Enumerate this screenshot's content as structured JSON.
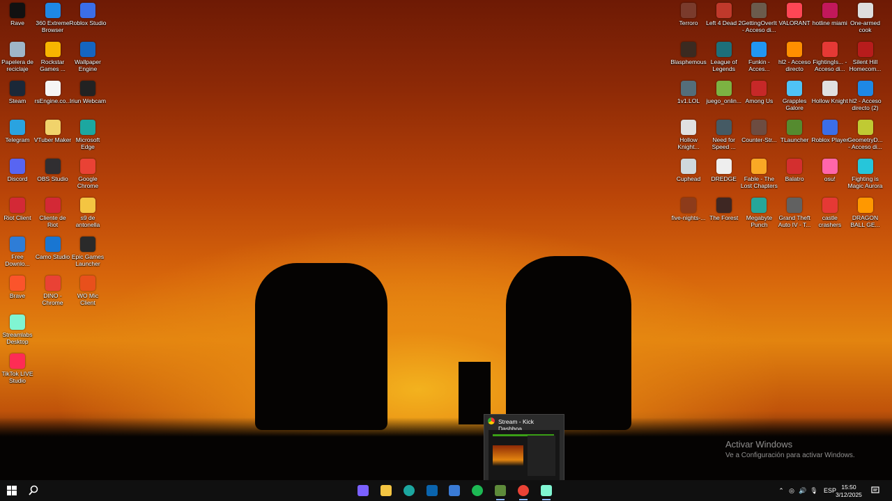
{
  "desktop_icons_left": [
    {
      "label": "Rave",
      "icon": "rave-icon",
      "color": "#111111"
    },
    {
      "label": "360 Extreme Browser",
      "icon": "360-browser-icon",
      "color": "#1e88e5"
    },
    {
      "label": "Roblox Studio",
      "icon": "roblox-studio-icon",
      "color": "#3b6ee8"
    },
    {
      "label": "Papelera de reciclaje",
      "icon": "recycle-bin-icon",
      "color": "#9fb6c8"
    },
    {
      "label": "Rockstar Games ...",
      "icon": "rockstar-icon",
      "color": "#f7b500"
    },
    {
      "label": "Wallpaper Engine",
      "icon": "wallpaper-engine-icon",
      "color": "#1565c0"
    },
    {
      "label": "Steam",
      "icon": "steam-icon",
      "color": "#1b2838"
    },
    {
      "label": "rsEngine.co...",
      "icon": "file-icon",
      "color": "#f5f5f5"
    },
    {
      "label": "Iriun Webcam",
      "icon": "iriun-icon",
      "color": "#222222"
    },
    {
      "label": "Telegram",
      "icon": "telegram-icon",
      "color": "#2aa3e0"
    },
    {
      "label": "VTuber Maker",
      "icon": "vtuber-maker-icon",
      "color": "#f1d36b"
    },
    {
      "label": "Microsoft Edge",
      "icon": "edge-icon",
      "color": "#1ca7a0"
    },
    {
      "label": "Discord",
      "icon": "discord-icon",
      "color": "#5865f2"
    },
    {
      "label": "OBS Studio",
      "icon": "obs-icon",
      "color": "#302e31"
    },
    {
      "label": "Google Chrome",
      "icon": "chrome-icon",
      "color": "#e94235"
    },
    {
      "label": "Riot Client",
      "icon": "riot-icon",
      "color": "#d32936"
    },
    {
      "label": "Cliente de Riot",
      "icon": "riot-icon",
      "color": "#d32936"
    },
    {
      "label": "s9 de antonella",
      "icon": "folder-icon",
      "color": "#f4c542"
    },
    {
      "label": "Free Downlo...",
      "icon": "free-download-icon",
      "color": "#2e7dd7"
    },
    {
      "label": "Camo Studio",
      "icon": "camo-icon",
      "color": "#1976d2"
    },
    {
      "label": "Epic Games Launcher",
      "icon": "epic-games-icon",
      "color": "#2a2a2a"
    },
    {
      "label": "Brave",
      "icon": "brave-icon",
      "color": "#fb542b"
    },
    {
      "label": "DINO - Chrome",
      "icon": "chrome-icon",
      "color": "#e94235"
    },
    {
      "label": "WO Mic Client",
      "icon": "mic-icon",
      "color": "#e8501c"
    },
    {
      "label": "Streamlabs Desktop",
      "icon": "streamlabs-icon",
      "color": "#80f5d2"
    },
    {
      "label": "TikTok LIVE Studio",
      "icon": "tiktok-icon",
      "color": "#fe2c55"
    }
  ],
  "desktop_icons_right": [
    {
      "label": "Terroro",
      "icon": "game-icon",
      "color": "#7a3b2c"
    },
    {
      "label": "Left 4 Dead 2",
      "icon": "game-icon",
      "color": "#c0392b"
    },
    {
      "label": "GettingOverIt - Acceso di...",
      "icon": "game-icon",
      "color": "#6b5b4c"
    },
    {
      "label": "VALORANT",
      "icon": "valorant-icon",
      "color": "#ff4655"
    },
    {
      "label": "hotline miami",
      "icon": "game-icon",
      "color": "#c2185b"
    },
    {
      "label": "One-armed cook",
      "icon": "game-icon",
      "color": "#dddddd"
    },
    {
      "label": "Blasphemous",
      "icon": "game-icon",
      "color": "#3b2a20"
    },
    {
      "label": "League of Legends",
      "icon": "lol-icon",
      "color": "#1d6f7a"
    },
    {
      "label": "Funkin - Acces...",
      "icon": "game-icon",
      "color": "#2196f3"
    },
    {
      "label": "hl2 - Acceso directo",
      "icon": "game-icon",
      "color": "#ff8f00"
    },
    {
      "label": "FightingIs... - Acceso di...",
      "icon": "game-icon",
      "color": "#e53935"
    },
    {
      "label": "Silent Hill Homecom...",
      "icon": "game-icon",
      "color": "#b71c1c"
    },
    {
      "label": "1v1.LOL",
      "icon": "game-icon",
      "color": "#546e7a"
    },
    {
      "label": "juego_onlin...",
      "icon": "game-icon",
      "color": "#7cb342"
    },
    {
      "label": "Among Us",
      "icon": "among-us-icon",
      "color": "#c62828"
    },
    {
      "label": "Grapples Galore",
      "icon": "game-icon",
      "color": "#4fc3f7"
    },
    {
      "label": "Hollow Knight",
      "icon": "game-icon",
      "color": "#e0e0e0"
    },
    {
      "label": "hl2 - Acceso directo (2)",
      "icon": "game-icon",
      "color": "#1e88e5"
    },
    {
      "label": "Hollow Knight...",
      "icon": "game-icon",
      "color": "#e0e0e0"
    },
    {
      "label": "Need for Speed ...",
      "icon": "game-icon",
      "color": "#455a64"
    },
    {
      "label": "Counter-Str...",
      "icon": "game-icon",
      "color": "#6d4c41"
    },
    {
      "label": "TLauncher",
      "icon": "game-icon",
      "color": "#558b2f"
    },
    {
      "label": "Roblox Player",
      "icon": "roblox-icon",
      "color": "#3b6ee8"
    },
    {
      "label": "GeometryD... - Acceso di...",
      "icon": "game-icon",
      "color": "#c0ca33"
    },
    {
      "label": "Cuphead",
      "icon": "game-icon",
      "color": "#cfd8dc"
    },
    {
      "label": "DREDGE",
      "icon": "game-icon",
      "color": "#eeeeee"
    },
    {
      "label": "Fable - The Lost Chapters",
      "icon": "game-icon",
      "color": "#f9a825"
    },
    {
      "label": "Balatro",
      "icon": "game-icon",
      "color": "#d32f2f"
    },
    {
      "label": "osu!",
      "icon": "osu-icon",
      "color": "#ff66aa"
    },
    {
      "label": "Fighting is Magic Aurora",
      "icon": "game-icon",
      "color": "#26c6da"
    },
    {
      "label": "five-nights-...",
      "icon": "game-icon",
      "color": "#8d3b1a"
    },
    {
      "label": "The Forest",
      "icon": "game-icon",
      "color": "#3e2723"
    },
    {
      "label": "Megabyte Punch",
      "icon": "game-icon",
      "color": "#26a69a"
    },
    {
      "label": "Grand Theft Auto IV - T...",
      "icon": "game-icon",
      "color": "#616161"
    },
    {
      "label": "castle crashers",
      "icon": "game-icon",
      "color": "#e53935"
    },
    {
      "label": "DRAGON BALL GE...",
      "icon": "game-icon",
      "color": "#ff9800"
    }
  ],
  "watermark": {
    "title": "Activar Windows",
    "subtitle": "Ve a Configuración para activar Windows."
  },
  "preview": {
    "title": "Stream - Kick Dashboa..."
  },
  "taskbar": {
    "apps": [
      {
        "name": "copilot-icon",
        "color": "#7b61ff"
      },
      {
        "name": "file-explorer-icon",
        "color": "#f4c542"
      },
      {
        "name": "edge-icon",
        "color": "#1ca7a0"
      },
      {
        "name": "mail-icon",
        "color": "#0a64ad"
      },
      {
        "name": "store-icon",
        "color": "#3a7bd5"
      },
      {
        "name": "spotify-icon",
        "color": "#1db954"
      },
      {
        "name": "minecraft-icon",
        "color": "#5d8a3a"
      },
      {
        "name": "chrome-icon",
        "color": "#e94235"
      },
      {
        "name": "streamlabs-icon",
        "color": "#80f5d2"
      }
    ],
    "language": "ESP",
    "time": "15:50",
    "date": "3/12/2025"
  }
}
